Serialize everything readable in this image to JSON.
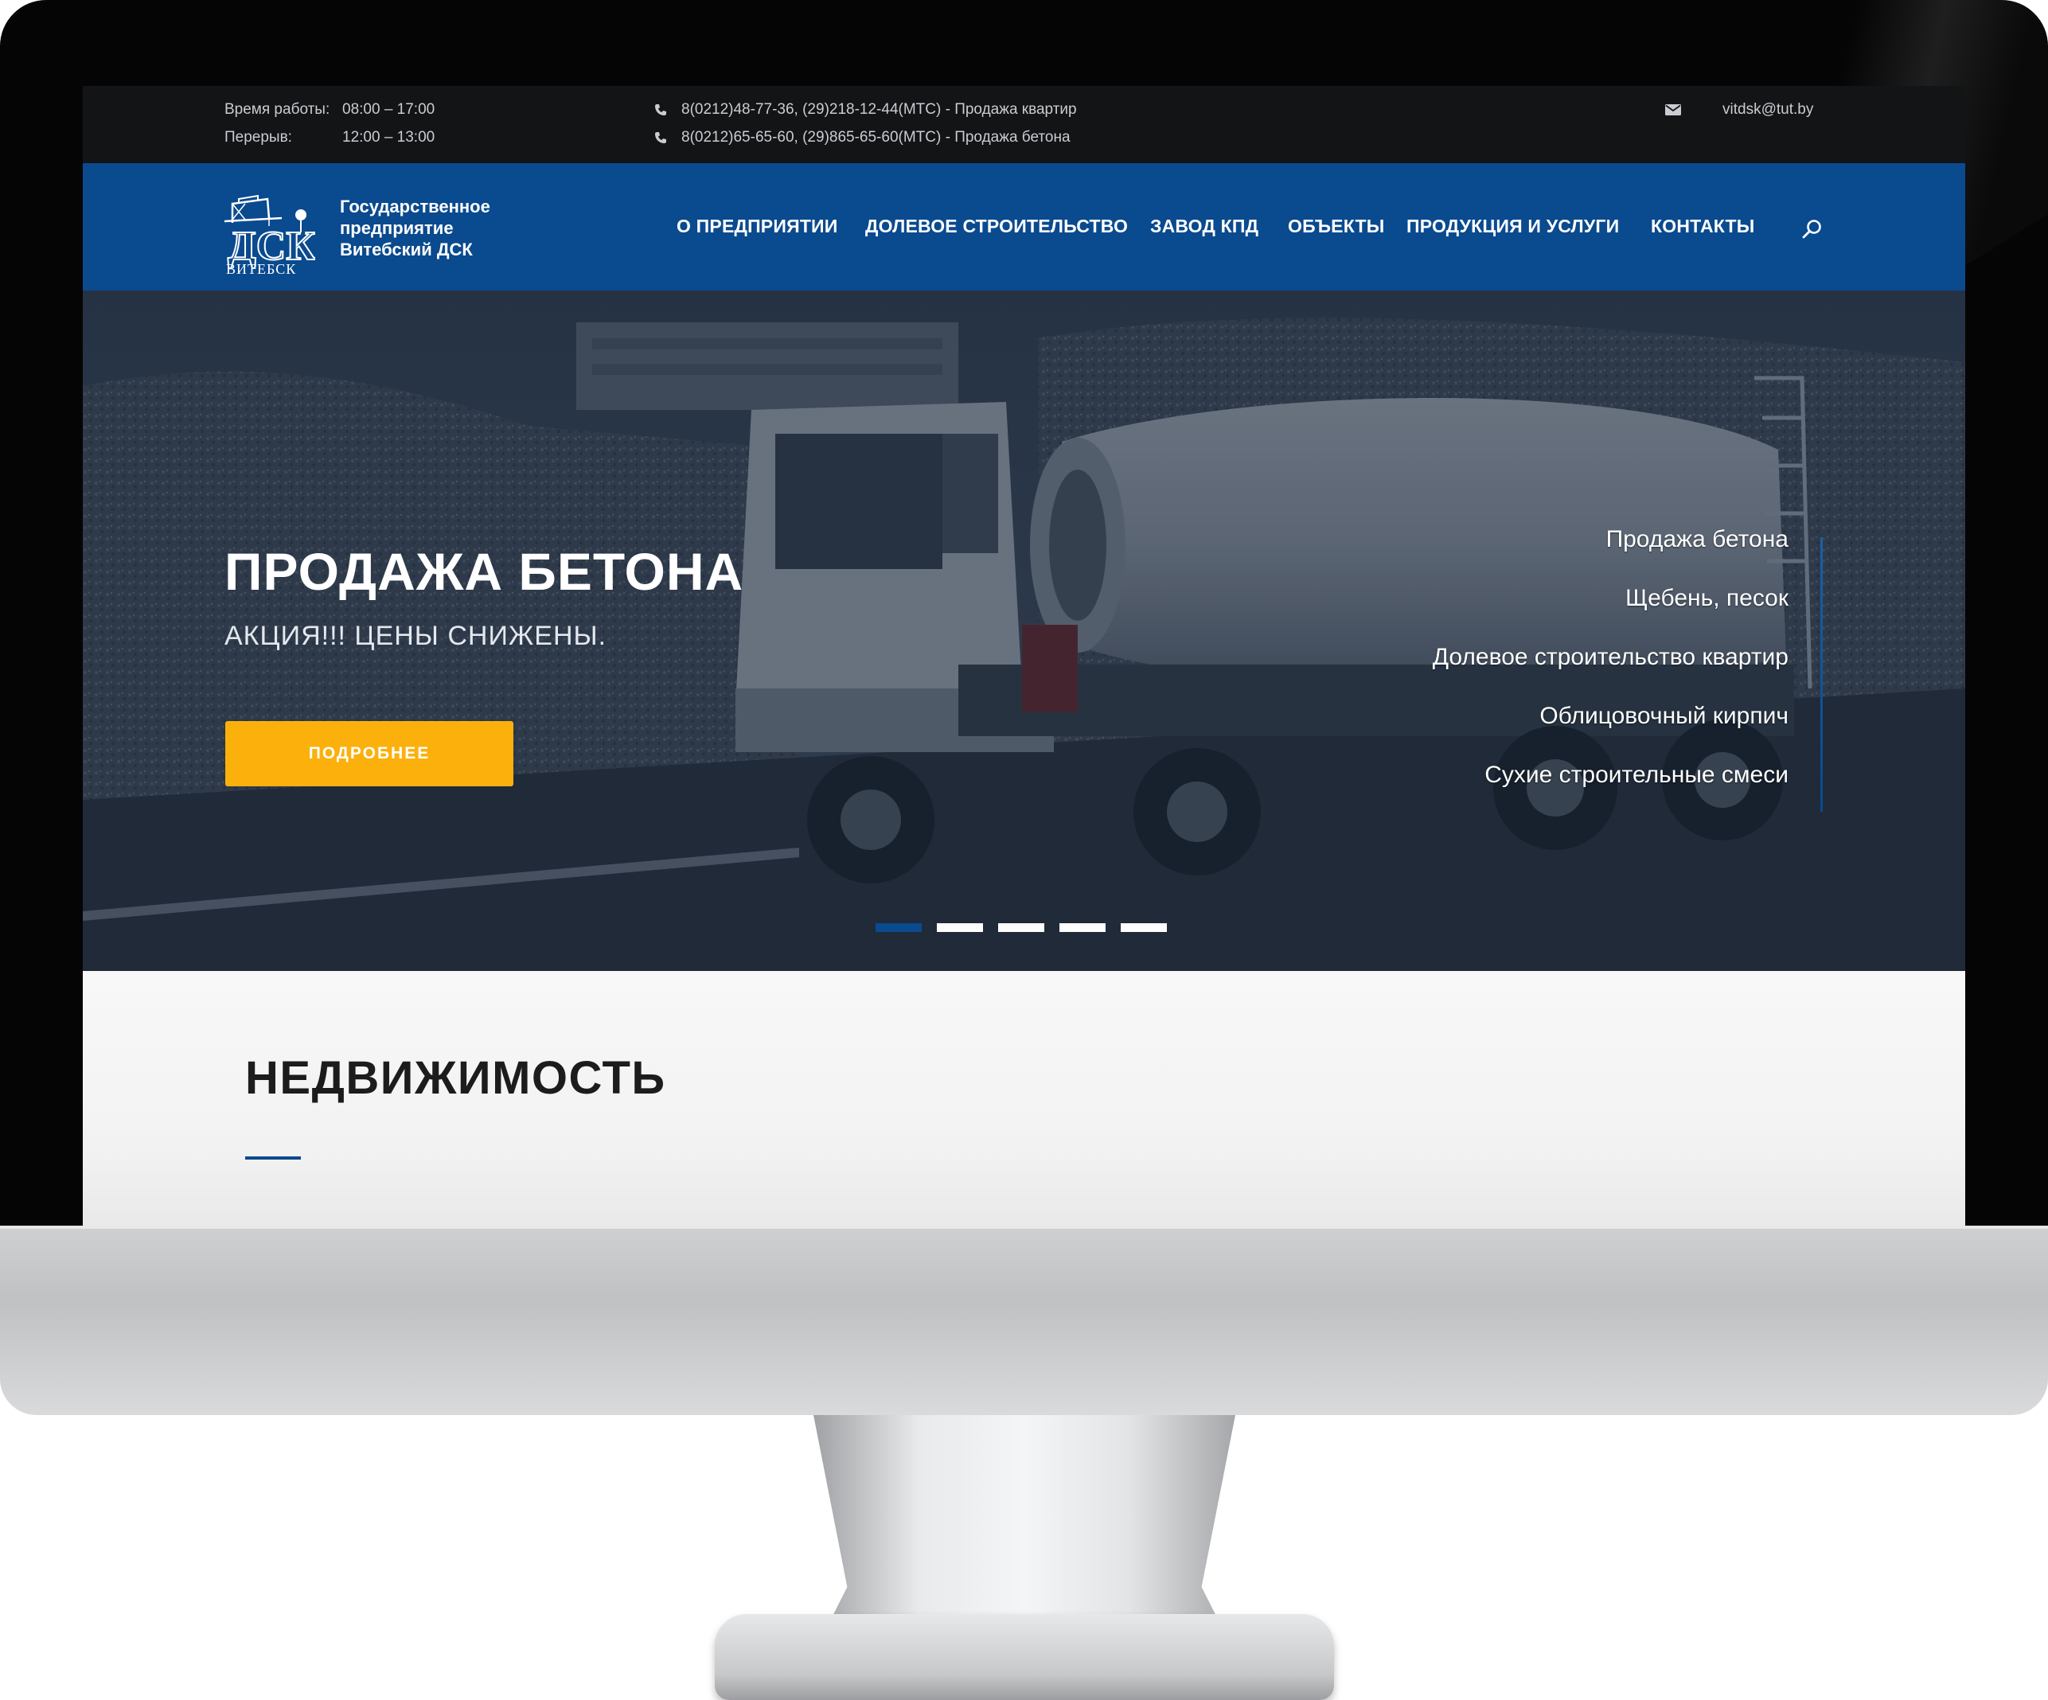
{
  "topbar": {
    "hours_label": "Время работы:",
    "hours_value": "08:00 – 17:00",
    "break_label": "Перерыв:",
    "break_value": "12:00 – 13:00",
    "phone_apartments": "8(0212)48-77-36, (29)218-12-44(МТС) - Продажа квартир",
    "phone_concrete": "8(0212)65-65-60, (29)865-65-60(МТС) - Продажа бетона",
    "email": "vitdsk@tut.by"
  },
  "logo": {
    "line1": "Государственное",
    "line2": "предприятие",
    "line3": "Витебский ДСК",
    "mark_text": "ДСК",
    "mark_subtext": "ВИТЕБСК"
  },
  "nav": {
    "items": [
      "О ПРЕДПРИЯТИИ",
      "ДОЛЕВОЕ СТРОИТЕЛЬСТВО",
      "ЗАВОД КПД",
      "ОБЪЕКТЫ",
      "ПРОДУКЦИЯ И УСЛУГИ",
      "КОНТАКТЫ"
    ],
    "search_icon": "search-icon"
  },
  "hero": {
    "title": "ПРОДАЖА БЕТОНА",
    "subtitle": "АКЦИЯ!!! ЦЕНЫ СНИЖЕНЫ.",
    "button_label": "ПОДРОБНЕЕ",
    "side_links": [
      "Продажа бетона",
      "Щебень, песок",
      "Долевое строительство квартир",
      "Облицовочный кирпич",
      "Сухие строительные смеси"
    ],
    "slides_total": 5,
    "active_slide": 1
  },
  "section": {
    "title": "НЕДВИЖИМОСТЬ"
  },
  "colors": {
    "brand_blue": "#0a4a8f",
    "accent_yellow": "#fbb00c",
    "topbar_bg": "#121416"
  }
}
